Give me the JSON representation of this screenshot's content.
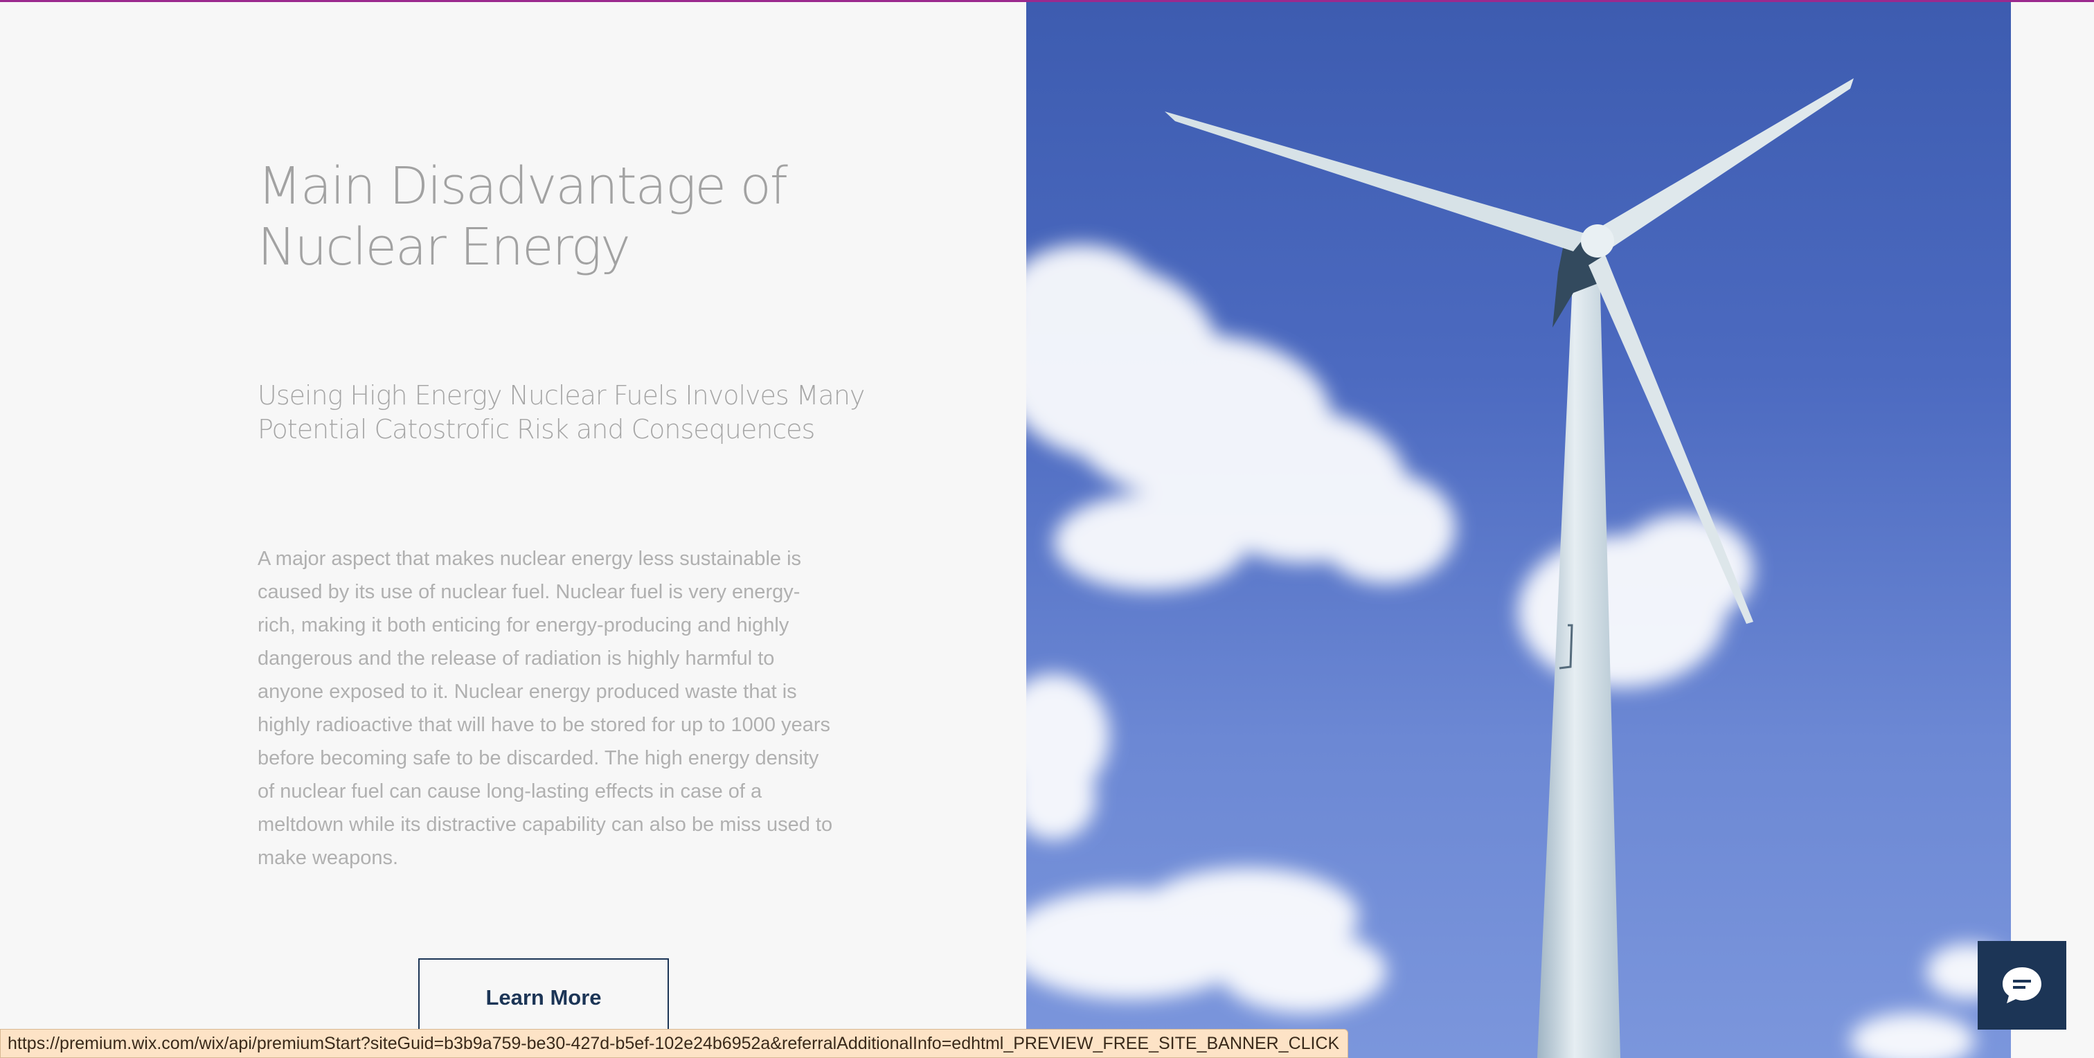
{
  "section": {
    "headline_line1": "Main Disadvantage of",
    "headline_line2": "Nuclear Energy",
    "subheading_line1": "Useing High Energy Nuclear Fuels Involves Many",
    "subheading_line2": "Potential Catostrofic Risk and Consequences",
    "body": "A major aspect that makes nuclear energy less sustainable is caused by its use of nuclear fuel. Nuclear fuel is very energy-rich, making it both enticing for energy-producing and highly dangerous and the release of radiation is highly harmful to anyone exposed to it. Nuclear energy produced waste that is highly radioactive that will have to be stored for up to 1000 years before becoming safe to be discarded. The high energy density of nuclear fuel can cause long-lasting effects in case of a meltdown while its distractive capability can also be miss used to make weapons.",
    "cta_label": "Learn More"
  },
  "hero_image": {
    "subject": "wind turbine against blue sky with clouds"
  },
  "chat": {
    "icon": "chat-bubble-icon"
  },
  "status_bar": {
    "url": "https://premium.wix.com/wix/api/premiumStart?siteGuid=b3b9a759-be30-427d-b5ef-102e24b6952a&referralAdditionalInfo=edhtml_PREVIEW_FREE_SITE_BANNER_CLICK"
  },
  "colors": {
    "accent_top": "#9b2a8e",
    "button_border": "#1c3556",
    "chat_bg": "#1c3556",
    "status_bg": "#fde3c6"
  }
}
